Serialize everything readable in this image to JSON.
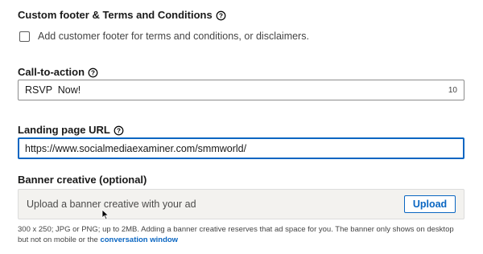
{
  "footer": {
    "title": "Custom footer & Terms and Conditions",
    "help_icon": "question-circle-icon",
    "checkbox_label": "Add customer footer for terms and conditions, or disclaimers."
  },
  "cta": {
    "title": "Call-to-action",
    "help_icon": "question-circle-icon",
    "value": "RSVP  Now!",
    "char_count": "10"
  },
  "landing": {
    "title": "Landing page URL",
    "help_icon": "question-circle-icon",
    "value": "https://www.socialmediaexaminer.com/smmworld/"
  },
  "banner": {
    "title": "Banner creative (optional)",
    "placeholder": "Upload a banner creative with your ad",
    "upload_label": "Upload",
    "hint_text": "300 x 250; JPG or PNG; up to 2MB. Adding a banner creative reserves that ad space for you. The banner only shows on desktop but not on mobile or the ",
    "hint_link": "conversation window"
  },
  "colors": {
    "accent": "#0a66c2",
    "banner_bg": "#f3f2ef"
  }
}
